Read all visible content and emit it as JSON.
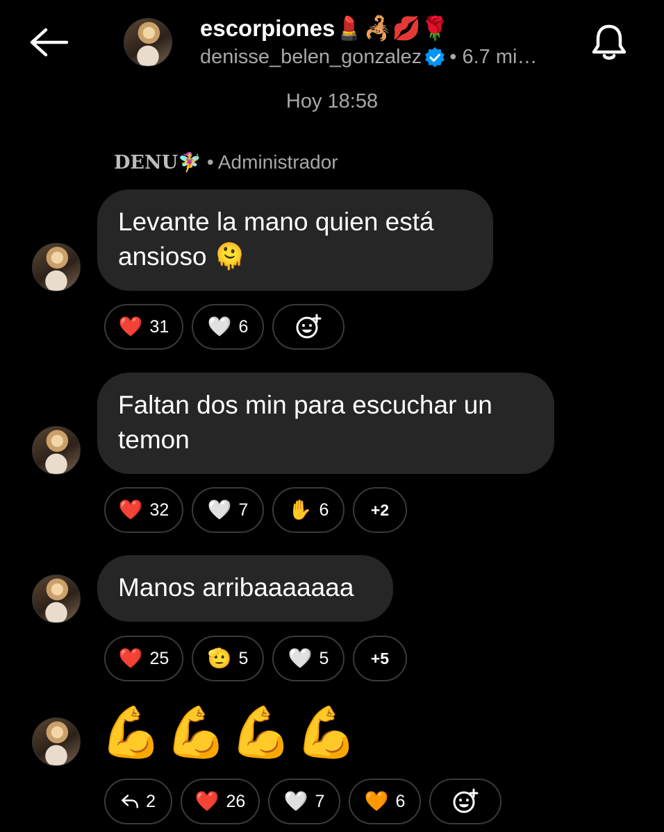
{
  "header": {
    "back_icon": "arrow-left-icon",
    "channel_title": "escorpiones💄🦂💋🌹",
    "owner_username": "denisse_belen_gonzalez",
    "members_text": "• 6.7 mi…",
    "bell_icon": "bell-icon"
  },
  "timestamp": "Hoy 18:58",
  "sender": {
    "name": "DENU🧚‍♀️",
    "role": "• Administrador"
  },
  "messages": [
    {
      "text": "Levante la mano quien está ansioso 🫠",
      "reactions": [
        {
          "emoji": "❤️",
          "count": "31"
        },
        {
          "emoji": "🤍",
          "count": "6"
        },
        {
          "emoji": "add-reaction-icon",
          "count": ""
        }
      ]
    },
    {
      "text": "Faltan dos min para escuchar un temon",
      "reactions": [
        {
          "emoji": "❤️",
          "count": "32"
        },
        {
          "emoji": "🤍",
          "count": "7"
        },
        {
          "emoji": "✋",
          "count": "6"
        },
        {
          "emoji": "",
          "count": "+2"
        }
      ]
    },
    {
      "text": "Manos arribaaaaaaa",
      "reactions": [
        {
          "emoji": "❤️",
          "count": "25"
        },
        {
          "emoji": "🫡",
          "count": "5"
        },
        {
          "emoji": "🤍",
          "count": "5"
        },
        {
          "emoji": "",
          "count": "+5"
        }
      ]
    },
    {
      "text": "💪💪💪💪",
      "reactions": [
        {
          "emoji": "reply-icon",
          "count": "2"
        },
        {
          "emoji": "❤️",
          "count": "26"
        },
        {
          "emoji": "🤍",
          "count": "7"
        },
        {
          "emoji": "🧡",
          "count": "6"
        },
        {
          "emoji": "add-reaction-icon",
          "count": ""
        }
      ]
    }
  ],
  "colors": {
    "background": "#000000",
    "bubble": "#262626",
    "muted_text": "#a8a8a8",
    "verified_blue": "#0095f6",
    "chip_border": "#3a3a3a"
  }
}
